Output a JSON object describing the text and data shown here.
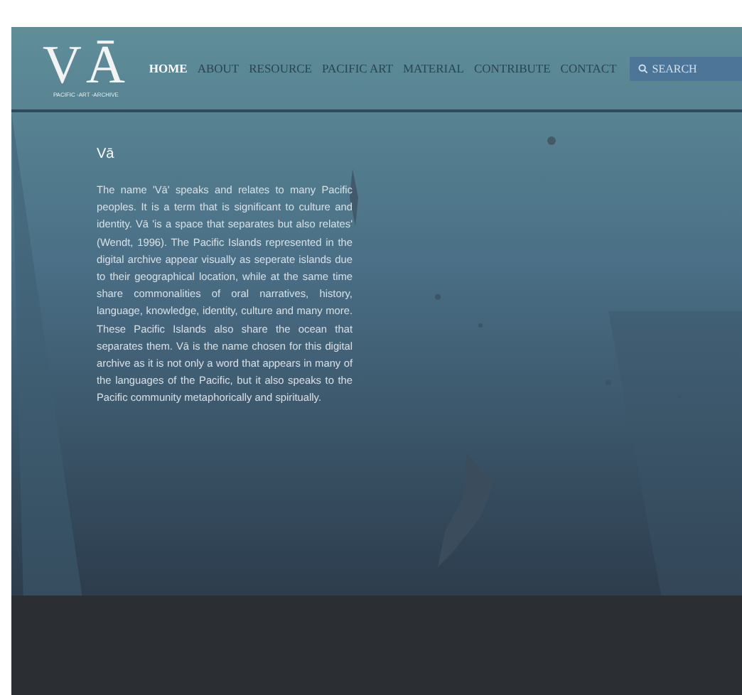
{
  "logo": {
    "mark": "VĀ",
    "tagline": "PACIFIC -ART -ARCHIVE"
  },
  "nav": [
    {
      "label": "HOME",
      "selected": true
    },
    {
      "label": "ABOUT",
      "selected": false
    },
    {
      "label": "RESOURCE",
      "selected": false
    },
    {
      "label": "PACIFIC ART",
      "selected": false
    },
    {
      "label": "MATERIAL",
      "selected": false
    },
    {
      "label": "CONTRIBUTE",
      "selected": false
    },
    {
      "label": "CONTACT",
      "selected": false
    }
  ],
  "search": {
    "placeholder": "SEARCH"
  },
  "hero": {
    "kind": "picture",
    "heading": "Vā",
    "body": "The name 'Vā' speaks and relates to many Pacific peoples. It is a term that is significant to culture and identity. Vā 'is a space that separates but also relates' (Wendt, 1996). The Pacific Islands represented in the digital archive appear visually as seperate islands due to their geographical location, while at the same time share commonalities of oral narratives, history, language, knowledge, identity, culture and many more. These Pacific Islands also share the ocean that separates them. Vā is the name chosen for this digital archive as it is not only a word that appears in many of the languages of the Pacific, but it also speaks to the Pacific community metaphorically and spiritually."
  }
}
